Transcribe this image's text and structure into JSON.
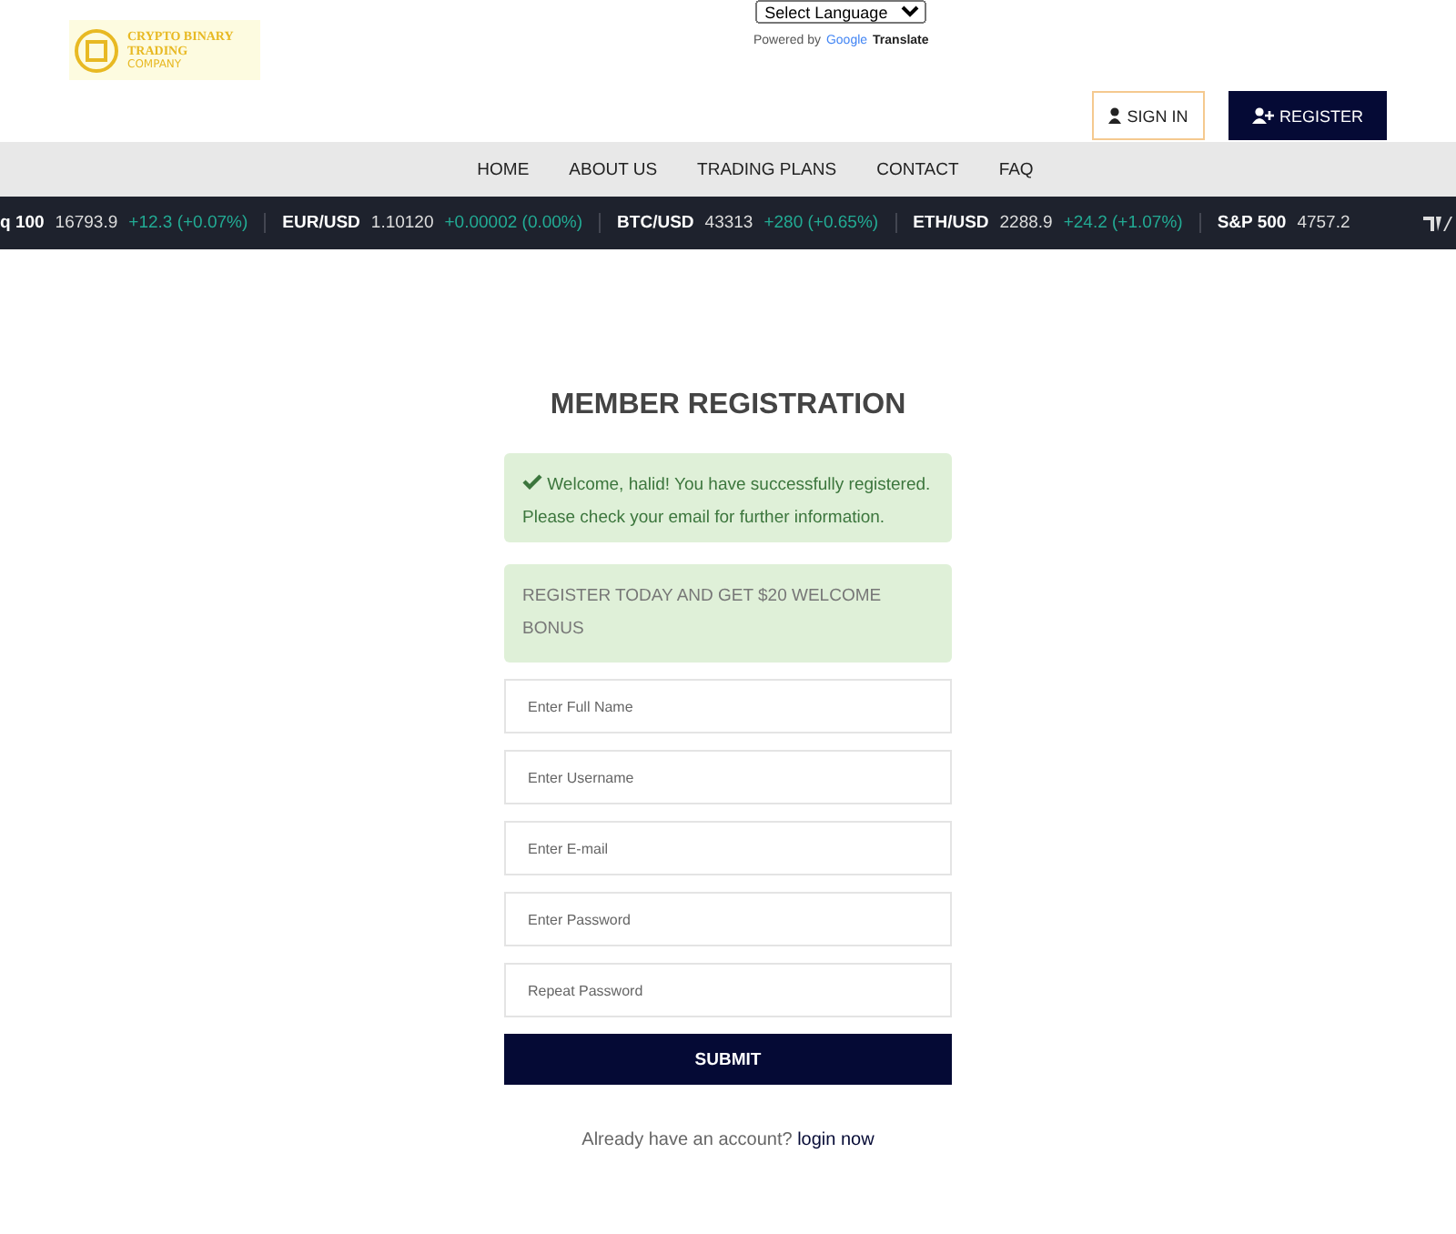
{
  "logo": {
    "title": "CRYPTO BINARY TRADING",
    "subtitle": "COMPANY"
  },
  "translate": {
    "select": "Select Language",
    "powered_by": "Powered by",
    "google": "Google",
    "translate": "Translate"
  },
  "auth_buttons": [
    {
      "label": "SIGN IN",
      "kind": "outline"
    },
    {
      "label": "REGISTER",
      "kind": "filled"
    }
  ],
  "nav": [
    "HOME",
    "ABOUT US",
    "TRADING PLANS",
    "CONTACT",
    "FAQ"
  ],
  "ticker": [
    {
      "symbol": "q 100",
      "price": "16793.9",
      "change": "+12.3 (+0.07%)"
    },
    {
      "symbol": "EUR/USD",
      "price": "1.10120",
      "change": "+0.00002 (0.00%)"
    },
    {
      "symbol": "BTC/USD",
      "price": "43313",
      "change": "+280 (+0.65%)"
    },
    {
      "symbol": "ETH/USD",
      "price": "2288.9",
      "change": "+24.2 (+1.07%)"
    },
    {
      "symbol": "S&P 500",
      "price": "4757.2"
    }
  ],
  "title": "MEMBER REGISTRATION",
  "alerts": [
    {
      "kind": "success",
      "text": "Welcome, halid! You have successfully registered. Please check your email for further information."
    },
    {
      "kind": "info",
      "text": "REGISTER TODAY AND GET $20 WELCOME BONUS"
    }
  ],
  "fields": [
    {
      "placeholder": "Enter Full Name"
    },
    {
      "placeholder": "Enter Username"
    },
    {
      "placeholder": "Enter E-mail"
    },
    {
      "placeholder": "Enter Password"
    },
    {
      "placeholder": "Repeat Password"
    }
  ],
  "submit": "SUBMIT",
  "footer": {
    "text": "Already have an account?",
    "link": "login now"
  }
}
